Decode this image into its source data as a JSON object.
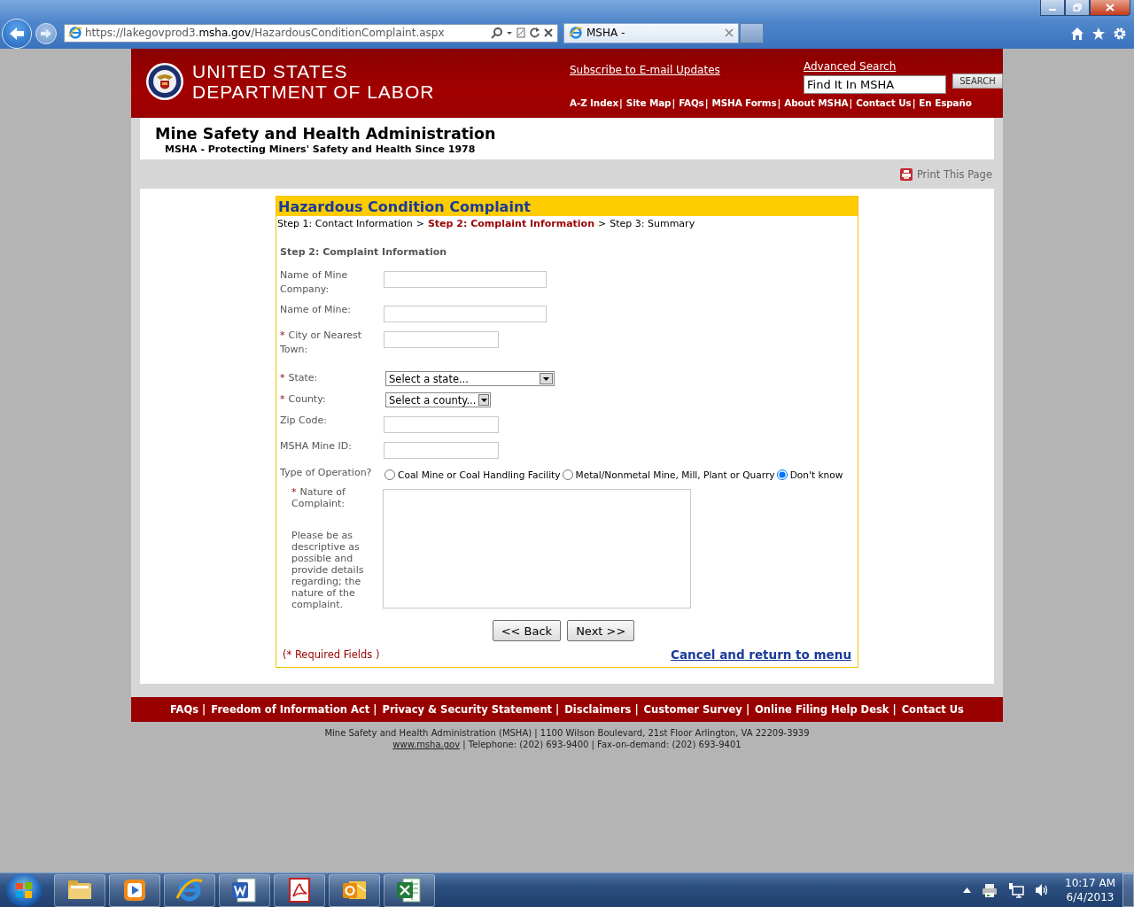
{
  "browser": {
    "url": "https://lakegovprod3.**msha.gov**/HazardousConditionComplaint.aspx",
    "tab_title": "MSHA -"
  },
  "header": {
    "agency": [
      "UNITED STATES",
      "DEPARTMENT OF LABOR"
    ],
    "subscribe_link": "Subscribe to E-mail Updates",
    "advanced_search_link": "Advanced Search",
    "search_field": {
      "value": "Find It In MSHA"
    },
    "search_button": "SEARCH",
    "separator": "|",
    "nav_links": [
      "A-Z Index",
      "Site Map",
      "FAQs",
      "MSHA Forms",
      "About MSHA",
      "Contact Us",
      "En Españo"
    ]
  },
  "agency_title": {
    "title": "Mine Safety and Health Administration",
    "subtitle": "MSHA - Protecting Miners' Safety and Health Since 1978"
  },
  "print_link": "Print This Page",
  "form": {
    "title": "Hazardous Condition Complaint",
    "step_separator": ">",
    "steps": [
      {
        "label": "Step 1: Contact Information",
        "selected": false
      },
      {
        "label": "Step 2: Complaint Information",
        "selected": true
      },
      {
        "label": "Step 3: Summary",
        "selected": false
      }
    ],
    "section_heading": "Step 2: Complaint Information",
    "fields": [
      {
        "kind": "widetext",
        "label": "Name of Mine Company:"
      },
      {
        "kind": "widetext",
        "label": "Name of Mine:"
      },
      {
        "kind": "text",
        "label": "City or Nearest Town:",
        "marker": "*"
      },
      {
        "kind": "wideselect",
        "label": "State:",
        "marker": "*",
        "value": "Select a state..."
      },
      {
        "kind": "select",
        "label": "County:",
        "marker": "*",
        "value": "Select a county..."
      },
      {
        "kind": "text",
        "label": "Zip Code:"
      },
      {
        "kind": "text",
        "label": "MSHA Mine ID:"
      }
    ],
    "operation": {
      "label": "Type of Operation?",
      "options": [
        {
          "label": "Coal Mine or Coal Handling Facility",
          "selected": false
        },
        {
          "label": "Metal/Nonmetal Mine, Mill, Plant or Quarry",
          "selected": false
        },
        {
          "label": "Don't know",
          "selected": true
        }
      ]
    },
    "complaint": {
      "marker": "*",
      "label": "Nature of Complaint:",
      "help": "Please be as descriptive as possible and provide details regarding; the nature of the complaint."
    },
    "buttons": [
      "<< Back",
      "Next >>"
    ],
    "required_note": "(* Required Fields )",
    "cancel_link": "Cancel and return to menu"
  },
  "footer": {
    "separator": "|",
    "links": [
      "FAQs",
      "Freedom of Information Act",
      "Privacy & Security Statement",
      "Disclaimers",
      "Customer Survey",
      "Online Filing Help Desk",
      "Contact Us"
    ],
    "address": "Mine Safety and Health Administration (MSHA) | 1100 Wilson Boulevard, 21st Floor Arlington, VA 22209-3939",
    "website_link": "www.msha.gov",
    "contact": "| Telephone: (202) 693-9400 | Fax-on-demand: (202) 693-9401"
  },
  "taskbar": {
    "apps": [
      {
        "kind": "folder"
      },
      {
        "kind": "media"
      },
      {
        "kind": "browser"
      },
      {
        "kind": "word"
      },
      {
        "kind": "pdf"
      },
      {
        "kind": "outlook"
      },
      {
        "kind": "excel"
      }
    ],
    "time": "10:17 AM",
    "date": "6/4/2013"
  }
}
